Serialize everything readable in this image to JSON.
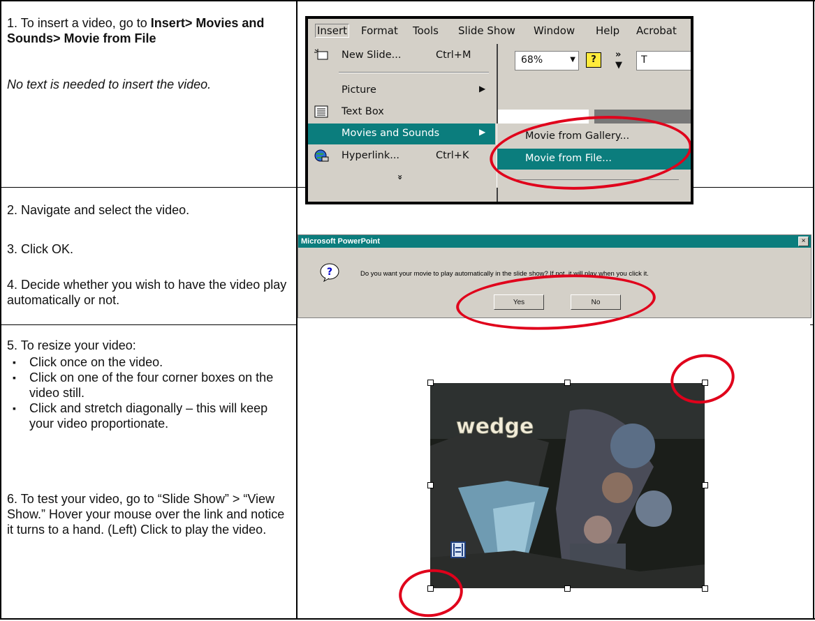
{
  "steps": {
    "s1_plain": "1. To insert a video, go to ",
    "s1_bold": "Insert> Movies and Sounds> Movie from File",
    "s1_note": "No text is needed to insert the video.",
    "s2": "2. Navigate and select the video.",
    "s3": "3. Click OK.",
    "s4": "4. Decide whether you wish to have the video play automatically or not.",
    "s5": "5. To resize your video:",
    "s5_bullets": [
      "Click once on the video.",
      "Click on one of the four corner boxes on the video still.",
      "Click and stretch diagonally – this will keep your video proportionate."
    ],
    "s6": "6. To test your video, go to  “Slide Show” > “View Show.” Hover your mouse over the link and notice it turns to a hand. (Left) Click to play the video."
  },
  "menu": {
    "bar": [
      "Insert",
      "Format",
      "Tools",
      "Slide Show",
      "Window",
      "Help",
      "Acrobat"
    ],
    "zoom": "68%",
    "toolbar_t": "T",
    "items": {
      "new_slide": "New Slide...",
      "new_slide_sc": "Ctrl+M",
      "picture": "Picture",
      "text_box": "Text Box",
      "movies_sounds": "Movies and Sounds",
      "hyperlink": "Hyperlink...",
      "hyperlink_sc": "Ctrl+K",
      "more": "»"
    },
    "submenu": {
      "gallery": "Movie from Gallery...",
      "file": "Movie from File..."
    }
  },
  "dialog": {
    "title": "Microsoft PowerPoint",
    "close": "×",
    "message": "Do you want your movie to play automatically in the slide show? If not, it will play when you click it.",
    "yes": "Yes",
    "no": "No"
  },
  "video": {
    "caption": "wedge"
  },
  "colors": {
    "highlight": "#0b7d7d",
    "annotation_red": "#e0001b",
    "win_gray": "#d4d0c8"
  }
}
